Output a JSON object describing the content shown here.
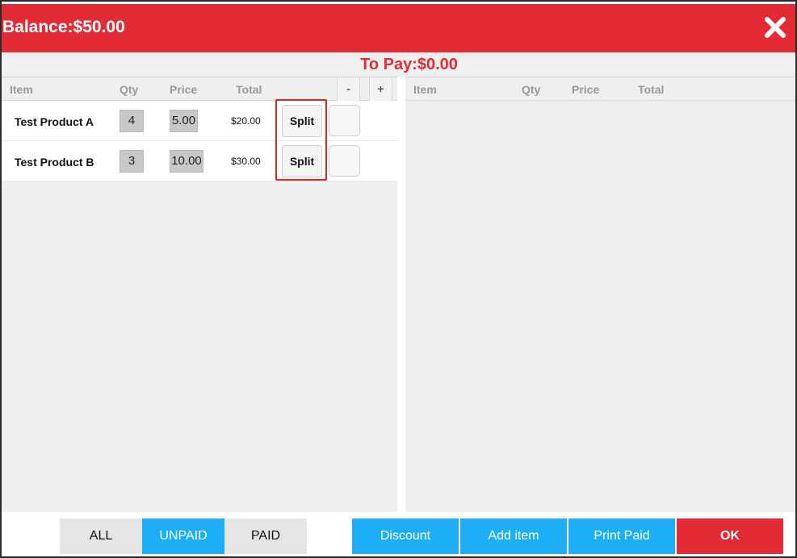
{
  "header": {
    "title": "Balance:$50.00",
    "close_icon": "close-icon"
  },
  "to_pay": "To Pay:$0.00",
  "left_table": {
    "columns": [
      "Item",
      "Qty",
      "Price",
      "Total"
    ],
    "minus_label": "-",
    "plus_label": "+",
    "rows": [
      {
        "name": "Test Product A",
        "qty": "4",
        "price": "5.00",
        "total": "$20.00",
        "split": "Split"
      },
      {
        "name": "Test Product B",
        "qty": "3",
        "price": "10.00",
        "total": "$30.00",
        "split": "Split"
      }
    ]
  },
  "right_table": {
    "columns": [
      "Item",
      "Qty",
      "Price",
      "Total"
    ]
  },
  "filters": {
    "all": "ALL",
    "unpaid": "UNPAID",
    "paid": "PAID"
  },
  "actions": {
    "discount": "Discount",
    "add_item": "Add item",
    "print_paid": "Print Paid",
    "ok": "OK"
  },
  "colors": {
    "brand_red": "#e32b35",
    "accent_blue": "#1eaef6",
    "highlight": "#e02424"
  }
}
